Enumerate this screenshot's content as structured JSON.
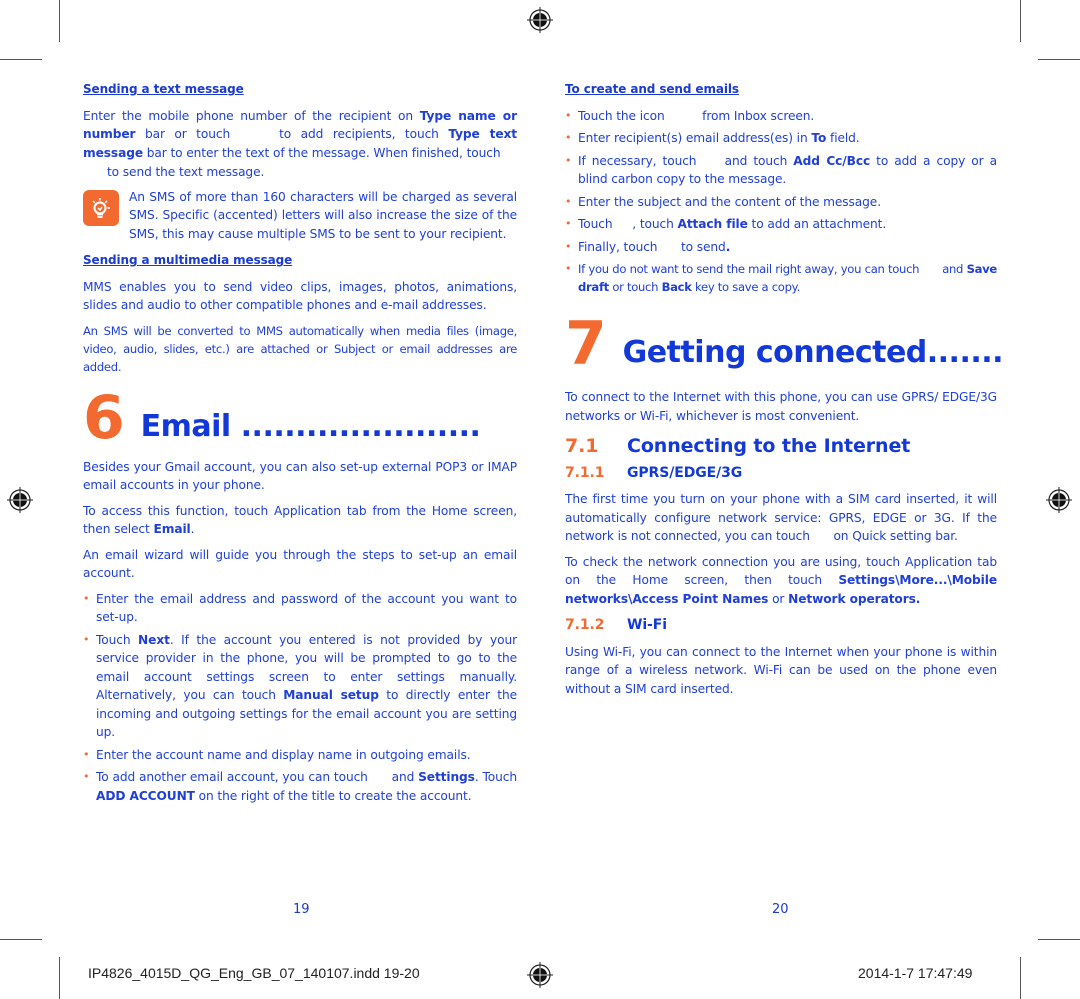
{
  "left_page": {
    "sending_text": {
      "heading": "Sending a text message",
      "p1_a": "Enter the mobile phone number of the recipient on ",
      "p1_b1": "Type name or number",
      "p1_c": " bar or touch ",
      "p1_d": " to add recipients, touch ",
      "p1_b2": "Type text message",
      "p1_e": " bar to enter the text of the message. When finished, touch",
      "p1_f": "to send the text message.",
      "tip_icon": "lightbulb-tip-icon",
      "tip": "An SMS of more than 160 characters will be charged as several SMS. Specific (accented) letters will also increase the size of the SMS, this may cause multiple SMS to be sent to your recipient."
    },
    "sending_mms": {
      "heading": "Sending a multimedia message",
      "p1": "MMS enables you to send video clips, images, photos, animations, slides and audio to other compatible phones and e-mail addresses.",
      "p2": "An SMS will be converted to MMS automatically when media files (image, video, audio, slides, etc.) are attached or Subject or email addresses are added."
    },
    "chapter": {
      "number": "6",
      "title": "Email ......................"
    },
    "email": {
      "p1": "Besides your Gmail account, you can also set-up external POP3 or IMAP email accounts in your phone.",
      "p2_a": "To access this function, touch Application tab from the Home screen, then select ",
      "p2_b": "Email",
      "p2_c": ".",
      "p3": "An email wizard will guide you through the steps to set-up an email account.",
      "bullets": [
        {
          "text": "Enter the email address and password of the account you want to set-up."
        },
        {
          "a": "Touch ",
          "b": "Next",
          "c": ". If the account you entered is not provided by your service provider in the phone, you will be prompted to go to the email account settings screen to enter settings manually. Alternatively, you can touch ",
          "d": "Manual setup",
          "e": " to directly enter the incoming and outgoing settings for the email account you are setting up."
        },
        {
          "text": "Enter the account name and display name in outgoing emails."
        },
        {
          "a": "To add another email account, you can touch ",
          "b": " and ",
          "c": "Settings",
          "d": ". Touch ",
          "e": "ADD ACCOUNT",
          "f": " on the right of the title to create the account."
        }
      ]
    },
    "page_number": "19"
  },
  "right_page": {
    "create_send": {
      "heading": "To create and send emails",
      "bullets": [
        {
          "a": "Touch the icon ",
          "b": " from Inbox screen."
        },
        {
          "a": "Enter recipient(s) email address(es) in ",
          "b": "To",
          "c": " field."
        },
        {
          "a": "If necessary, touch ",
          "b": " and touch ",
          "c": "Add Cc/Bcc",
          "d": " to add a copy or a blind carbon copy to the message."
        },
        {
          "a": "Enter the subject and the content of the message."
        },
        {
          "a": "Touch ",
          "b": ", touch ",
          "c": "Attach file",
          "d": " to add an attachment."
        },
        {
          "a": "Finally, touch ",
          "b": " to send",
          "c": "."
        },
        {
          "a": "If you do not want to send the mail right away, you can touch ",
          "b": " and ",
          "c": "Save draft",
          "d": " or touch ",
          "e": "Back",
          "f": " key to save a copy."
        }
      ]
    },
    "chapter": {
      "number": "7",
      "title": "Getting connected......."
    },
    "intro": "To connect to the Internet with this phone, you can use GPRS/ EDGE/3G networks or Wi-Fi, whichever is most convenient.",
    "section_7_1": {
      "number": "7.1",
      "title": "Connecting to the Internet"
    },
    "section_7_1_1": {
      "number": "7.1.1",
      "title": "GPRS/EDGE/3G",
      "p1_a": "The first time you turn on your phone with a SIM card inserted, it will automatically configure network service: GPRS, EDGE or 3G. If the network is not connected, you can touch ",
      "p1_b": " on Quick setting bar.",
      "p2_a": "To check the network connection you are using, touch Application tab on the Home screen, then touch ",
      "p2_b": "Settings\\More...\\Mobile networks\\Access Point Names",
      "p2_c": " or ",
      "p2_d": "Network operators."
    },
    "section_7_1_2": {
      "number": "7.1.2",
      "title": "Wi-Fi",
      "p1": "Using Wi-Fi, you can connect to the Internet when your phone is within range of a wireless network. Wi-Fi can be used on the phone even without a SIM card inserted."
    },
    "page_number": "20"
  },
  "slug": {
    "filename": "IP4826_4015D_QG_Eng_GB_07_140107.indd   19-20",
    "timestamp": "2014-1-7   17:47:49"
  },
  "colors": {
    "text_blue": "#1f3fd6",
    "heading_blue": "#1238d8",
    "accent_orange": "#f26a2f"
  }
}
